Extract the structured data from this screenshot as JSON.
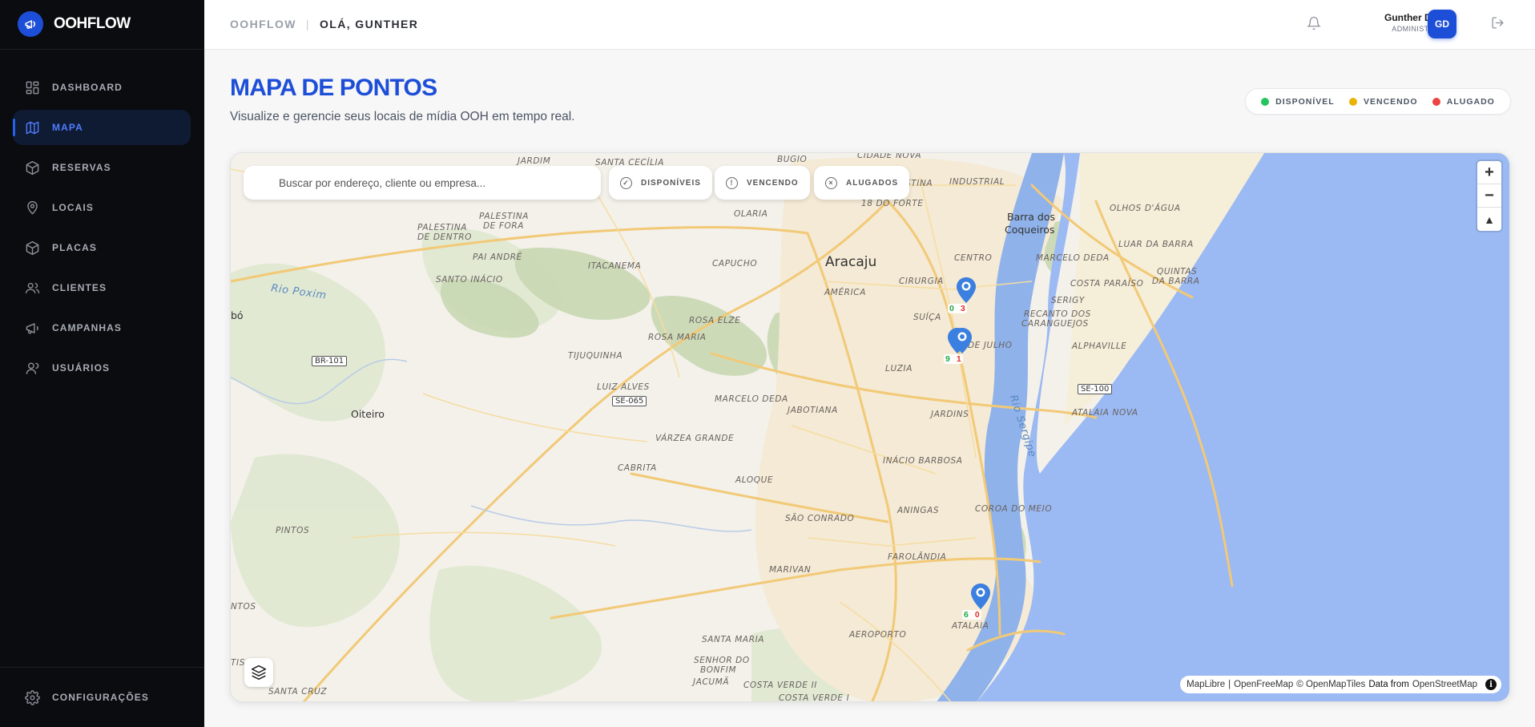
{
  "app": {
    "name": "OOHFLOW"
  },
  "sidebar": {
    "items": [
      {
        "label": "DASHBOARD",
        "icon": "dashboard-icon"
      },
      {
        "label": "MAPA",
        "icon": "map-icon",
        "active": true
      },
      {
        "label": "RESERVAS",
        "icon": "box-icon"
      },
      {
        "label": "LOCAIS",
        "icon": "location-pin-icon"
      },
      {
        "label": "PLACAS",
        "icon": "box-icon"
      },
      {
        "label": "CLIENTES",
        "icon": "users-icon"
      },
      {
        "label": "CAMPANHAS",
        "icon": "megaphone-icon"
      },
      {
        "label": "USUÁRIOS",
        "icon": "user-icon"
      }
    ],
    "settings_label": "CONFIGURAÇÕES"
  },
  "header": {
    "app_crumb": "OOHFLOW",
    "separator": "|",
    "greeting": "OLÁ, GUNTHER",
    "user_name": "Gunther Dantas",
    "user_role": "ADMINISTRADOR",
    "avatar_initials": "GD"
  },
  "page": {
    "title": "MAPA DE PONTOS",
    "subtitle": "Visualize e gerencie seus locais de mídia OOH em tempo real."
  },
  "legend": [
    {
      "label": "DISPONÍVEL",
      "color": "#22c55e"
    },
    {
      "label": "VENCENDO",
      "color": "#eab308"
    },
    {
      "label": "ALUGADO",
      "color": "#ef4444"
    }
  ],
  "map": {
    "search_placeholder": "Buscar por endereço, cliente ou empresa...",
    "filters": [
      {
        "label": "DISPONÍVEIS",
        "icon": "check-circle-icon"
      },
      {
        "label": "VENCENDO",
        "icon": "alert-circle-icon"
      },
      {
        "label": "ALUGADOS",
        "icon": "x-circle-icon"
      }
    ],
    "zoom_in": "+",
    "zoom_out": "−",
    "compass": "▲",
    "attribution": {
      "maplibre": "MapLibre",
      "sep": "|",
      "openfreemap": "OpenFreeMap",
      "omt": "© OpenMapTiles",
      "data_from": "Data from",
      "osm": "OpenStreetMap",
      "info": "i"
    },
    "labels": {
      "aracaju": "Aracaju",
      "barra_line1": "Barra dos",
      "barra_line2": "Coqueiros",
      "oiteiro": "Oiteiro",
      "jardim": "JARDIM",
      "santa_cecilia": "SANTA CECÍLIA",
      "bugio": "BUGIO",
      "cidade_nova": "CIDADE NOVA",
      "industrial": "INDUSTRIAL",
      "stina": "STINA",
      "dezoito_forte": "18 DO FORTE",
      "olhos_dagua": "OLHOS D'ÁGUA",
      "palestina_dentro_1": "PALESTINA",
      "palestina_dentro_2": "DE DENTRO",
      "palestina_fora_1": "PALESTINA",
      "palestina_fora_2": "DE FORA",
      "olaria": "OLARIA",
      "luar_barra": "LUAR DA BARRA",
      "pai_andre": "PAI ANDRÉ",
      "itacanema": "ITACANEMA",
      "capucho": "CAPUCHO",
      "centro": "CENTRO",
      "marcelo_deda_1": "MARCELO DEDA",
      "quintas_1": "QUINTAS",
      "quintas_2": "DA BARRA",
      "rio_poxim": "Rio Poxim",
      "santo_inacio": "SANTO INÁCIO",
      "america": "AMÉRICA",
      "cirurgia": "CIRURGIA",
      "costa_paraiso": "COSTA PARAÍSO",
      "sergy": "SERIGY",
      "abo": "bó",
      "rosa_elze": "ROSA ELZE",
      "suica": "SUÍÇA",
      "recanto_1": "RECANTO DOS",
      "recanto_2": "CARANGUEJOS",
      "rosa_maria": "ROSA MARIA",
      "dejulho": "DE JULHO",
      "alphaville": "ALPHAVILLE",
      "tijuquinha": "TIJUQUINHA",
      "luzia": "LUZIA",
      "luiz_alves": "LUIZ ALVES",
      "marcelo_deda_2": "MARCELO DEDA",
      "rio_sergipe": "Rio Sergipe",
      "atalaia_nova": "ATALAIA NOVA",
      "jabotiana": "JABOTIANA",
      "jardins": "JARDINS",
      "varzea_grande": "VÁRZEA GRANDE",
      "inacio_barbosa": "INÁCIO BARBOSA",
      "cabrita": "CABRITA",
      "aloque": "ALOQUE",
      "coroa_meio": "COROA DO MEIO",
      "aningas": "ANINGAS",
      "sao_conrado": "SÃO CONRADO",
      "pintos": "PINTOS",
      "farolandia": "FAROLÂNDIA",
      "marivan": "MARIVAN",
      "ntos": "NTOS",
      "aeroporto": "AEROPORTO",
      "atalaia": "ATALAIA",
      "santa_maria": "SANTA MARIA",
      "senhor_1": "SENHOR DO",
      "senhor_2": "BONFIM",
      "tis": "TIS",
      "jacuma": "JACUMÃ",
      "costa_verde_2": "COSTA VERDE II",
      "costa_verde_1": "COSTA VERDE I",
      "santa_cruz": "SANTA CRUZ"
    },
    "shields": {
      "br101": "BR-101",
      "se065": "SE-065",
      "se100": "SE-100"
    },
    "markers": [
      {
        "available": "0",
        "rented": "3"
      },
      {
        "available": "9",
        "rented": "1"
      },
      {
        "available": "6",
        "rented": "0"
      }
    ]
  }
}
